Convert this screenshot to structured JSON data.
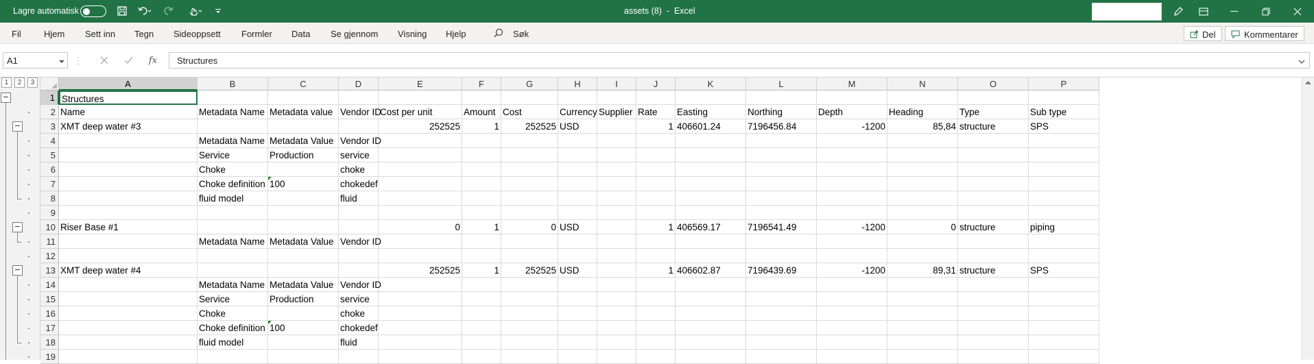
{
  "titlebar": {
    "autosave_label": "Lagre automatisk",
    "doc_title": "assets (8)",
    "separator": "-",
    "app_name": "Excel"
  },
  "menu": {
    "items": [
      "Fil",
      "Hjem",
      "Sett inn",
      "Tegn",
      "Sideoppsett",
      "Formler",
      "Data",
      "Se gjennom",
      "Visning",
      "Hjelp"
    ],
    "search_label": "Søk",
    "share_label": "Del",
    "comments_label": "Kommentarer"
  },
  "formula_bar": {
    "name_box": "A1",
    "fx": "fx",
    "content": "Structures"
  },
  "outline": {
    "levels": [
      "1",
      "2",
      "3"
    ]
  },
  "grid": {
    "columns": [
      "A",
      "B",
      "C",
      "D",
      "E",
      "F",
      "G",
      "H",
      "I",
      "J",
      "K",
      "L",
      "M",
      "N",
      "O",
      "P"
    ],
    "rows": [
      {
        "n": "1",
        "cells": [
          "Structures",
          "",
          "",
          "",
          "",
          "",
          "",
          "",
          "",
          "",
          "",
          "",
          "",
          "",
          "",
          ""
        ]
      },
      {
        "n": "2",
        "cells": [
          "Name",
          "Metadata Name",
          "Metadata value",
          "Vendor ID",
          "Cost per unit",
          "Amount",
          "Cost",
          "Currency",
          "Supplier",
          "Rate",
          "Easting",
          "Northing",
          "Depth",
          "Heading",
          "Type",
          "Sub type"
        ]
      },
      {
        "n": "3",
        "cells": [
          "XMT deep water #3",
          "",
          "",
          "",
          "252525",
          "1",
          "252525",
          "USD",
          "",
          "1",
          "406601.24",
          "7196456.84",
          "-1200",
          "85,84",
          "structure",
          "SPS"
        ]
      },
      {
        "n": "4",
        "cells": [
          "",
          "Metadata Name",
          "Metadata Value",
          "Vendor ID",
          "",
          "",
          "",
          "",
          "",
          "",
          "",
          "",
          "",
          "",
          "",
          ""
        ]
      },
      {
        "n": "5",
        "cells": [
          "",
          "Service",
          "Production",
          "service",
          "",
          "",
          "",
          "",
          "",
          "",
          "",
          "",
          "",
          "",
          "",
          ""
        ]
      },
      {
        "n": "6",
        "cells": [
          "",
          "Choke",
          "",
          "choke",
          "",
          "",
          "",
          "",
          "",
          "",
          "",
          "",
          "",
          "",
          "",
          ""
        ]
      },
      {
        "n": "7",
        "cells": [
          "",
          "Choke definition",
          "100",
          "chokedef",
          "",
          "",
          "",
          "",
          "",
          "",
          "",
          "",
          "",
          "",
          "",
          ""
        ]
      },
      {
        "n": "8",
        "cells": [
          "",
          "fluid model",
          "",
          "fluid",
          "",
          "",
          "",
          "",
          "",
          "",
          "",
          "",
          "",
          "",
          "",
          ""
        ]
      },
      {
        "n": "9",
        "cells": [
          "",
          "",
          "",
          "",
          "",
          "",
          "",
          "",
          "",
          "",
          "",
          "",
          "",
          "",
          "",
          ""
        ]
      },
      {
        "n": "10",
        "cells": [
          "Riser Base #1",
          "",
          "",
          "",
          "0",
          "1",
          "0",
          "USD",
          "",
          "1",
          "406569.17",
          "7196541.49",
          "-1200",
          "0",
          "structure",
          "piping"
        ]
      },
      {
        "n": "11",
        "cells": [
          "",
          "Metadata Name",
          "Metadata Value",
          "Vendor ID",
          "",
          "",
          "",
          "",
          "",
          "",
          "",
          "",
          "",
          "",
          "",
          ""
        ]
      },
      {
        "n": "12",
        "cells": [
          "",
          "",
          "",
          "",
          "",
          "",
          "",
          "",
          "",
          "",
          "",
          "",
          "",
          "",
          "",
          ""
        ]
      },
      {
        "n": "13",
        "cells": [
          "XMT deep water #4",
          "",
          "",
          "",
          "252525",
          "1",
          "252525",
          "USD",
          "",
          "1",
          "406602.87",
          "7196439.69",
          "-1200",
          "89,31",
          "structure",
          "SPS"
        ]
      },
      {
        "n": "14",
        "cells": [
          "",
          "Metadata Name",
          "Metadata Value",
          "Vendor ID",
          "",
          "",
          "",
          "",
          "",
          "",
          "",
          "",
          "",
          "",
          "",
          ""
        ]
      },
      {
        "n": "15",
        "cells": [
          "",
          "Service",
          "Production",
          "service",
          "",
          "",
          "",
          "",
          "",
          "",
          "",
          "",
          "",
          "",
          "",
          ""
        ]
      },
      {
        "n": "16",
        "cells": [
          "",
          "Choke",
          "",
          "choke",
          "",
          "",
          "",
          "",
          "",
          "",
          "",
          "",
          "",
          "",
          "",
          ""
        ]
      },
      {
        "n": "17",
        "cells": [
          "",
          "Choke definition",
          "100",
          "chokedef",
          "",
          "",
          "",
          "",
          "",
          "",
          "",
          "",
          "",
          "",
          "",
          ""
        ]
      },
      {
        "n": "18",
        "cells": [
          "",
          "fluid model",
          "",
          "fluid",
          "",
          "",
          "",
          "",
          "",
          "",
          "",
          "",
          "",
          "",
          "",
          ""
        ]
      },
      {
        "n": "19",
        "cells": [
          "",
          "",
          "",
          "",
          "",
          "",
          "",
          "",
          "",
          "",
          "",
          "",
          "",
          "",
          "",
          ""
        ]
      }
    ],
    "selected_cell": "A1",
    "text_number_cells": [
      "7-2",
      "17-2"
    ]
  },
  "colors": {
    "excel_green": "#217346",
    "ribbon_bg": "#f3f2f1",
    "header_bg": "#f2f2f2"
  }
}
